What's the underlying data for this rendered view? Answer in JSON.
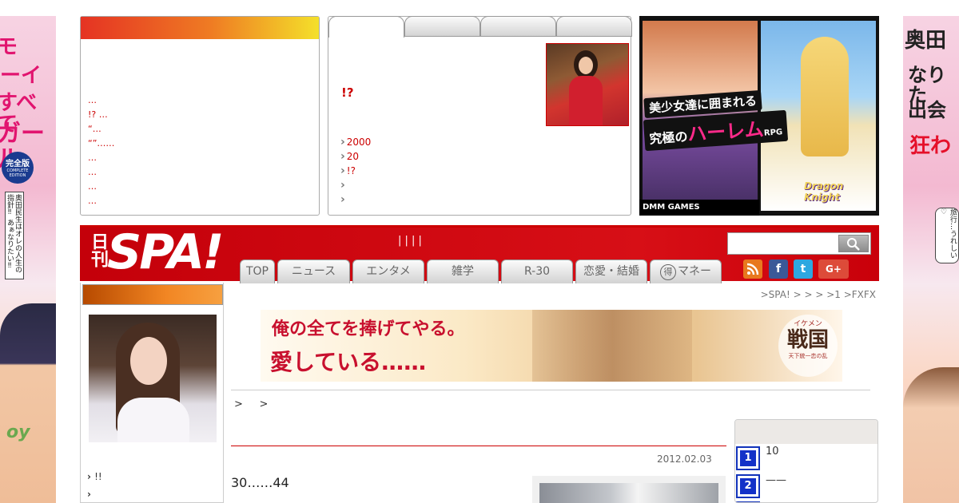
{
  "ad_left": {
    "list": [
      "…",
      "!? …",
      "“…",
      "“”……",
      " …",
      "…",
      "…",
      "…"
    ]
  },
  "ad_center": {
    "headline": "!?",
    "links": [
      "2000",
      "20",
      "!?",
      "",
      ""
    ]
  },
  "game_ad": {
    "catch_line1": "美少女達に囲まれる",
    "catch_line2_prefix": "究極の",
    "catch_line2_main": "ハーレム",
    "catch_line2_suffix": "RPG",
    "game_title": "Dragon Knight",
    "brand": "DMM GAMES"
  },
  "side_left": {
    "line1": "モ",
    "line2": "ーイ",
    "line3": "すべて",
    "line4": "ガール",
    "badge_main": "完全版",
    "badge_sub": "COMPLETE EDITION",
    "quote": "奥田民生はオレの人生の指針‼ あぁなりたい‼",
    "bottom": "oy"
  },
  "side_right": {
    "line1": "奥田",
    "line2": "なりた",
    "line3": "出会",
    "line4": "狂わ",
    "speech": "旅行…うれしい♡"
  },
  "header": {
    "logo_small": "日刊",
    "logo_big": "SPA!",
    "center_links": "| | | |",
    "nav": [
      "TOP",
      "ニュース",
      "エンタメ",
      "雑学",
      "R-30",
      "恋愛・結婚",
      "マネー"
    ],
    "money_prefix": "得"
  },
  "social": {
    "rss": "rss-icon",
    "facebook": "f",
    "twitter": "t",
    "gplus": "G+"
  },
  "left_col": {
    "links": [
      "!!",
      ""
    ]
  },
  "main": {
    "breadcrumb_top": ">SPA!  >  >  >  >1  >FXFX",
    "ad_text_line1": "俺の全てを捧げてやる。",
    "ad_text_line2": "愛している……",
    "ad_logo": "戦国",
    "ad_logo_ruby": "イケメン",
    "ad_logo_sub": "天下統一恋の乱",
    "breadcrumb": ">     >",
    "date": "2012.02.03",
    "article_title": "30……44"
  },
  "ranking": {
    "items": [
      {
        "num": "1",
        "text": "10"
      },
      {
        "num": "2",
        "text": "——"
      }
    ]
  }
}
